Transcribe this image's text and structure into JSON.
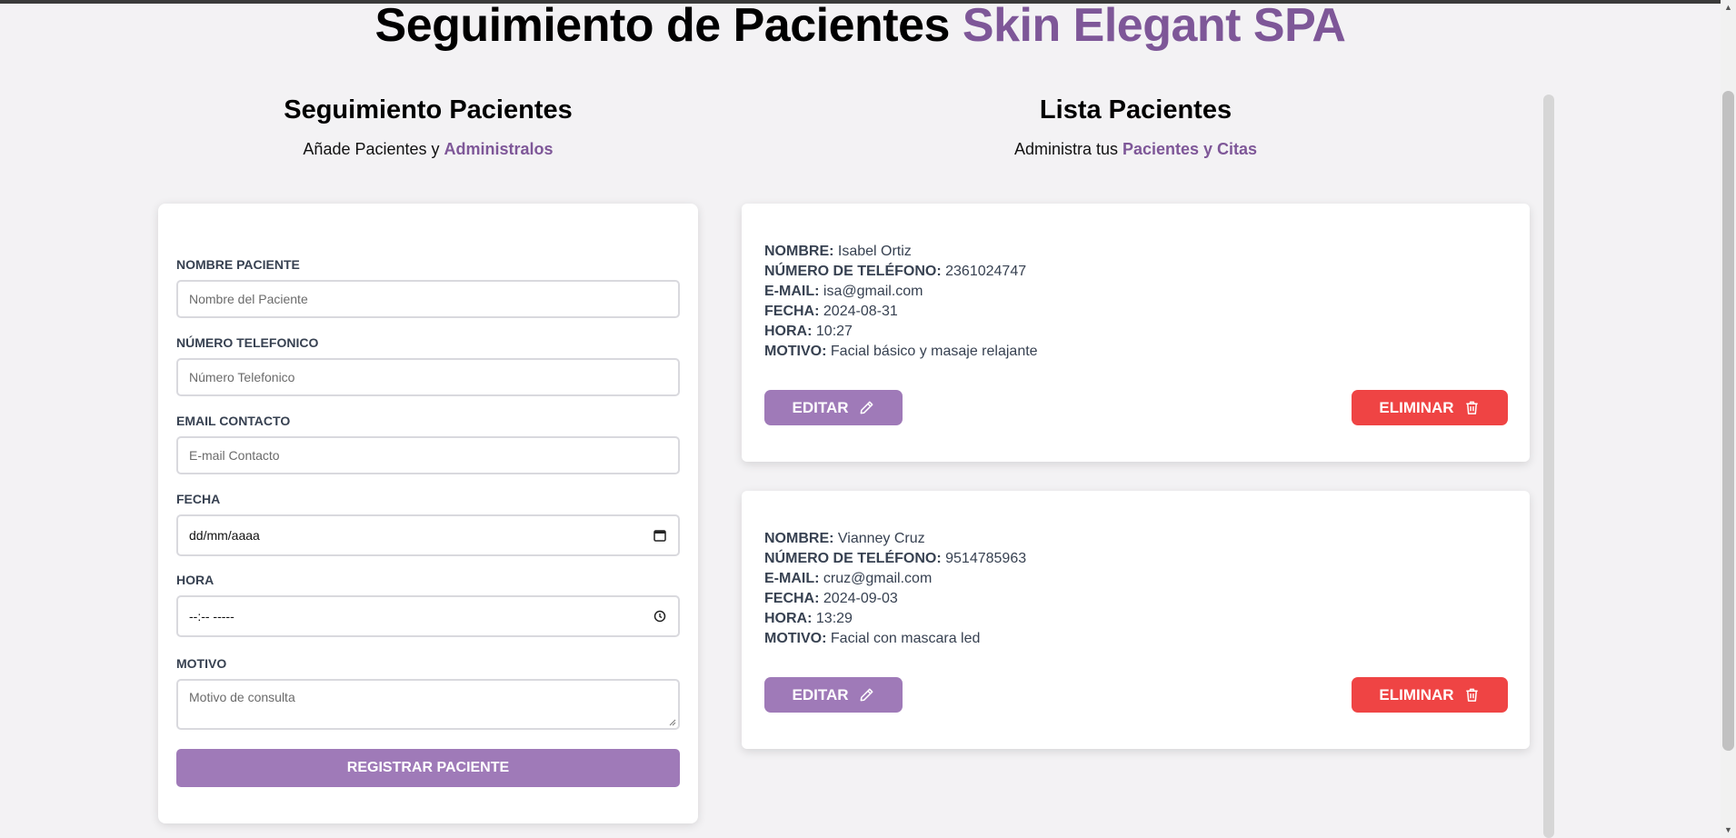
{
  "header": {
    "title_main": "Seguimiento de Pacientes",
    "title_accent": "Skin Elegant SPA"
  },
  "form_section": {
    "title": "Seguimiento Pacientes",
    "subtitle_plain": "Añade Pacientes y ",
    "subtitle_accent": "Administralos",
    "fields": {
      "nombre": {
        "label": "Nombre Paciente",
        "placeholder": "Nombre del Paciente"
      },
      "telefono": {
        "label": "Número Telefonico",
        "placeholder": "Número Telefonico"
      },
      "email": {
        "label": "Email Contacto",
        "placeholder": "E-mail Contacto"
      },
      "fecha": {
        "label": "Fecha",
        "value": "dd/mm/aaaa"
      },
      "hora": {
        "label": "Hora",
        "value": "--:-- -----"
      },
      "motivo": {
        "label": "Motivo",
        "placeholder": "Motivo de consulta"
      }
    },
    "submit_label": "Registrar Paciente"
  },
  "list_section": {
    "title": "Lista Pacientes",
    "subtitle_plain": "Administra tus ",
    "subtitle_accent": "Pacientes y Citas",
    "labels": {
      "nombre": "Nombre:",
      "telefono": "Número de teléfono:",
      "email": "E-mail:",
      "fecha": "Fecha:",
      "hora": "Hora:",
      "motivo": "Motivo:"
    },
    "edit_label": "Editar",
    "delete_label": "Eliminar",
    "patients": [
      {
        "nombre": "Isabel Ortiz",
        "telefono": "2361024747",
        "email": "isa@gmail.com",
        "fecha": "2024-08-31",
        "hora": "10:27",
        "motivo": "Facial básico y masaje relajante"
      },
      {
        "nombre": "Vianney Cruz",
        "telefono": "9514785963",
        "email": "cruz@gmail.com",
        "fecha": "2024-09-03",
        "hora": "13:29",
        "motivo": "Facial con mascara led"
      }
    ]
  },
  "colors": {
    "accent": "#7e5798",
    "button_primary": "#9f7ab8",
    "button_danger": "#ef4444",
    "background": "#f3f2f4"
  },
  "icons": {
    "edit": "pencil-icon",
    "delete": "trash-icon",
    "calendar": "calendar-icon",
    "clock": "clock-icon"
  }
}
